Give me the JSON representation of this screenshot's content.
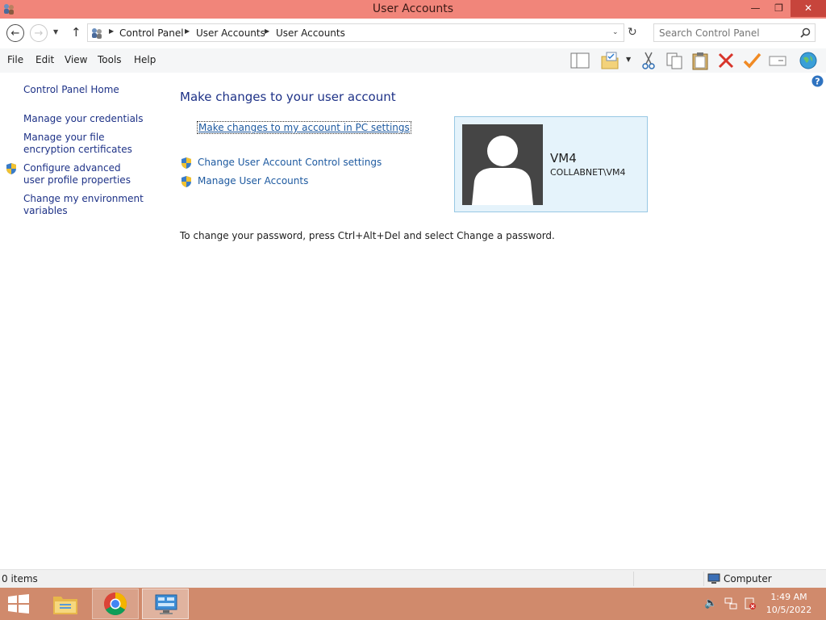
{
  "window": {
    "title": "User Accounts",
    "controls": {
      "minimize": "—",
      "restore": "❐",
      "close": "✕"
    }
  },
  "address": {
    "breadcrumbs": [
      "Control Panel",
      "User Accounts",
      "User Accounts"
    ],
    "search_placeholder": "Search Control Panel"
  },
  "menu": {
    "items": [
      "File",
      "Edit",
      "View",
      "Tools",
      "Help"
    ]
  },
  "toolbar": {
    "icons": [
      "layout-pane-icon",
      "properties-folder-icon",
      "cut-icon",
      "copy-icon",
      "paste-icon",
      "delete-icon",
      "check-icon",
      "rename-icon",
      "globe-icon"
    ]
  },
  "sidebar": {
    "home": "Control Panel Home",
    "links": [
      "Manage your credentials",
      "Manage your file encryption certificates",
      "Configure advanced user profile properties",
      "Change my environment variables"
    ]
  },
  "main": {
    "heading": "Make changes to your user account",
    "pc_settings_link": "Make changes to my account in PC settings",
    "uac_link": "Change User Account Control settings",
    "manage_link": "Manage User Accounts",
    "password_notice": "To change your password, press Ctrl+Alt+Del and select Change a password."
  },
  "user": {
    "name": "VM4",
    "domain": "COLLABNET\\VM4"
  },
  "status": {
    "count": "0 items",
    "zone": "Computer"
  },
  "taskbar": {
    "time": "1:49 AM",
    "date": "10/5/2022"
  },
  "colors": {
    "titlebar": "#f1857a",
    "taskbar": "#d08a6c",
    "link": "#1e5aa0",
    "heading": "#1e3287",
    "card_bg": "#e5f3fb"
  }
}
